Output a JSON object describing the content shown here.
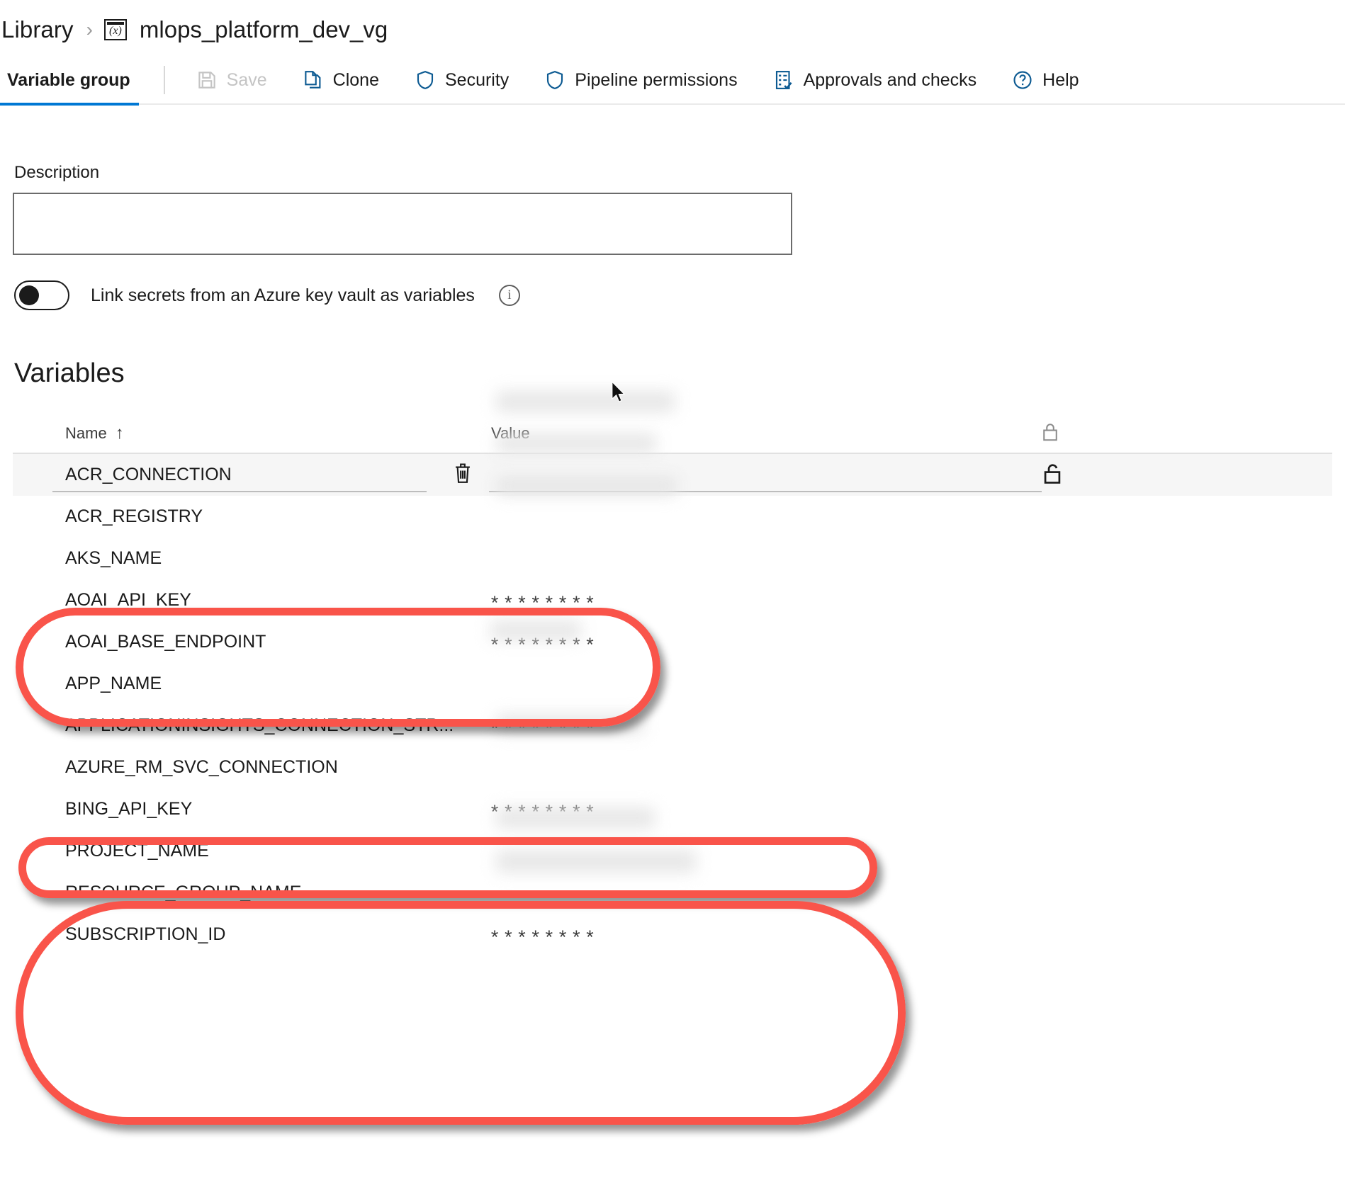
{
  "breadcrumb": {
    "root": "Library",
    "separator": "›",
    "group_icon": "variable-group-icon",
    "group_icon_glyph": "(x)",
    "current": "mlops_platform_dev_vg"
  },
  "toolbar": {
    "active_tab": "Variable group",
    "buttons": [
      {
        "label": "Save",
        "icon": "save-icon",
        "disabled": true
      },
      {
        "label": "Clone",
        "icon": "clone-icon",
        "disabled": false
      },
      {
        "label": "Security",
        "icon": "shield-icon",
        "disabled": false
      },
      {
        "label": "Pipeline permissions",
        "icon": "shield-icon",
        "disabled": false
      },
      {
        "label": "Approvals and checks",
        "icon": "checklist-icon",
        "disabled": false
      },
      {
        "label": "Help",
        "icon": "help-circle-icon",
        "disabled": false
      }
    ],
    "accent_color": "#0078d4"
  },
  "description": {
    "label": "Description",
    "value": "",
    "placeholder": ""
  },
  "key_vault": {
    "toggle_state": "off",
    "label": "Link secrets from an Azure key vault as variables",
    "info_icon": "info-icon",
    "info_glyph": "i"
  },
  "variables": {
    "title": "Variables",
    "columns": {
      "name": "Name",
      "name_sort": "↑",
      "value": "Value",
      "lock": "lock-icon"
    },
    "masked_placeholder": "********",
    "rows": [
      {
        "name": "ACR_CONNECTION",
        "value_display": "",
        "redacted": true,
        "selected": true,
        "lock_icon": "unlock-icon",
        "delete_icon": "trash-icon"
      },
      {
        "name": "ACR_REGISTRY",
        "value_display": "",
        "redacted": true,
        "selected": false
      },
      {
        "name": "AKS_NAME",
        "value_display": "",
        "redacted": true,
        "selected": false
      },
      {
        "name": "AOAI_API_KEY",
        "value_display": "********",
        "redacted": false,
        "selected": false
      },
      {
        "name": "AOAI_BASE_ENDPOINT",
        "value_display": "********",
        "redacted": false,
        "selected": false
      },
      {
        "name": "APP_NAME",
        "value_display": "",
        "redacted": true,
        "selected": false
      },
      {
        "name": "APPLICATIONINSIGHTS_CONNECTION_STR...",
        "value_display": "********",
        "redacted": false,
        "selected": false
      },
      {
        "name": "AZURE_RM_SVC_CONNECTION",
        "value_display": "",
        "redacted": true,
        "selected": false
      },
      {
        "name": "BING_API_KEY",
        "value_display": "********",
        "redacted": false,
        "selected": false
      },
      {
        "name": "PROJECT_NAME",
        "value_display": "",
        "redacted": true,
        "selected": false
      },
      {
        "name": "RESOURCE_GROUP_NAME",
        "value_display": "",
        "redacted": true,
        "selected": false
      },
      {
        "name": "SUBSCRIPTION_ID",
        "value_display": "********",
        "redacted": false,
        "selected": false
      }
    ]
  },
  "annotations": {
    "color": "#f9544a",
    "ovals": [
      {
        "name": "highlight-oval-aoai",
        "covers": [
          "AOAI_API_KEY",
          "AOAI_BASE_ENDPOINT"
        ]
      },
      {
        "name": "highlight-oval-azure-rm-svc-connection",
        "covers": [
          "AZURE_RM_SVC_CONNECTION"
        ]
      },
      {
        "name": "highlight-oval-project-scope",
        "covers": [
          "BING_API_KEY",
          "PROJECT_NAME",
          "RESOURCE_GROUP_NAME",
          "SUBSCRIPTION_ID"
        ]
      }
    ]
  }
}
